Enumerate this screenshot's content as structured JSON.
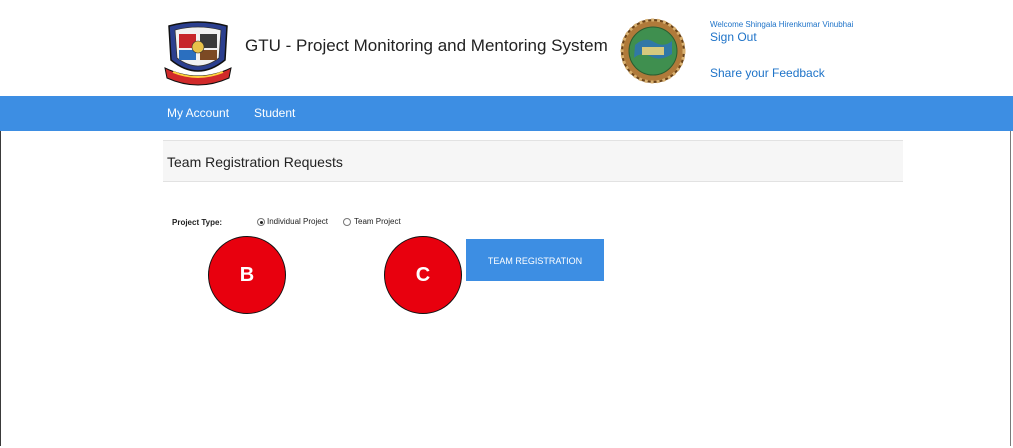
{
  "header": {
    "title": "GTU - Project Monitoring and Mentoring System",
    "welcome_text": "Welcome Shingala Hirenkumar Vinubhai",
    "sign_out": "Sign Out",
    "feedback": "Share your Feedback"
  },
  "nav": {
    "items": [
      {
        "label": "My Account"
      },
      {
        "label": "Student"
      }
    ]
  },
  "main": {
    "panel_title": "Team Registration Requests",
    "project_type_label": "Project Type:",
    "options": [
      {
        "label": "Individual Project",
        "selected": true
      },
      {
        "label": "Team Project",
        "selected": false
      }
    ],
    "team_registration_button": "TEAM REGISTRATION"
  },
  "annotations": {
    "marker_b": "B",
    "marker_c": "C"
  },
  "colors": {
    "nav_blue": "#3d8ee3",
    "link_blue": "#1e73c8",
    "marker_red": "#e8000e"
  },
  "icons": {
    "left_logo": "gtu-crest-logo",
    "right_logo": "globe-emblem-logo"
  }
}
